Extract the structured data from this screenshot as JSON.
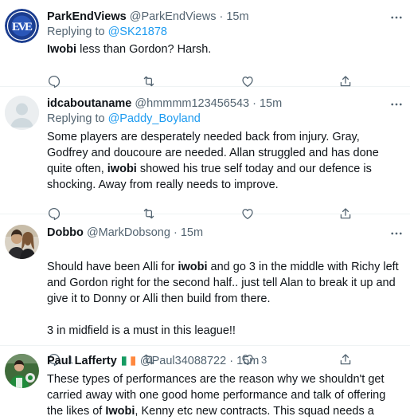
{
  "tweets": [
    {
      "name": "ParkEndViews",
      "handle": "@ParkEndViews",
      "sep": " · ",
      "time": "15m",
      "reply_prefix": "Replying to ",
      "reply_to": "@SK21878",
      "text_parts": [
        {
          "text": "Iwobi",
          "bold": true
        },
        {
          "text": " less than Gordon? Harsh.",
          "bold": false
        }
      ],
      "reply_count": "",
      "like_count": ""
    },
    {
      "name": "idcaboutaname",
      "handle": "@hmmmm123456543",
      "sep": " · ",
      "time": "15m",
      "reply_prefix": "Replying to ",
      "reply_to": "@Paddy_Boyland",
      "text_parts": [
        {
          "text": "Some players are desperately needed back from injury. Gray, Godfrey and doucoure are needed. Allan struggled and has done quite often, ",
          "bold": false
        },
        {
          "text": "iwobi",
          "bold": true
        },
        {
          "text": " showed his true self today and our defence is shocking. Away from really needs to improve.",
          "bold": false
        }
      ],
      "reply_count": "",
      "like_count": ""
    },
    {
      "name": "Dobbo",
      "handle": "@MarkDobsong",
      "sep": " · ",
      "time": "15m",
      "reply_prefix": "",
      "reply_to": "",
      "text_parts": [
        {
          "text": "Should have been Alli for ",
          "bold": false
        },
        {
          "text": "iwobi",
          "bold": true
        },
        {
          "text": " and go 3 in the middle with Richy left and Gordon right for the second half.. just tell Alan to break it up and give it to Donny or Alli then build from there.\n\n3 in midfield is a must in this league!!",
          "bold": false
        }
      ],
      "reply_count": "1",
      "like_count": "3"
    },
    {
      "name": "Paul Lafferty",
      "handle": "@Paul34088722",
      "sep": " · ",
      "time": "15m",
      "reply_prefix": "",
      "reply_to": "",
      "text_parts": [
        {
          "text": "These types of performances are the reason why we shouldn't get carried away with one good home performance and talk  of offering the likes of ",
          "bold": false
        },
        {
          "text": "Iwobi",
          "bold": true
        },
        {
          "text": ", Kenny etc new contracts. This squad needs a total overhaul",
          "bold": false
        }
      ],
      "reply_count": "",
      "like_count": ""
    }
  ],
  "colors": {
    "accent": "#1d9bf0",
    "muted": "#536471",
    "text": "#0f1419",
    "divider": "#eff3f4"
  },
  "icons": [
    "more-icon",
    "reply-icon",
    "retweet-icon",
    "like-icon",
    "share-icon",
    "ireland-flag-icon"
  ]
}
